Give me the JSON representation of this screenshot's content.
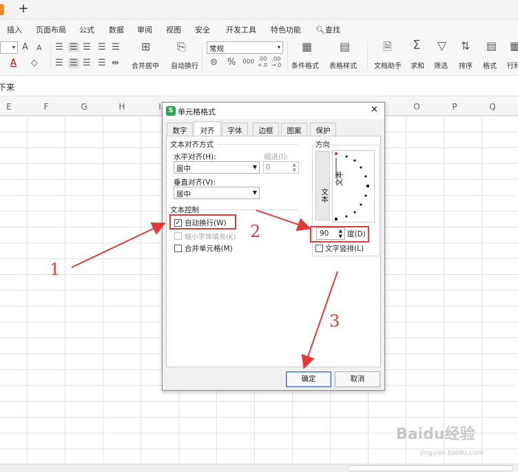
{
  "tabstrip": {
    "new_tab_glyph": "+"
  },
  "menu": [
    "插入",
    "页面布局",
    "公式",
    "数据",
    "审阅",
    "视图",
    "安全",
    "开发工具",
    "特色功能",
    "查找"
  ],
  "ribbon": {
    "font_size_value": "",
    "font_grow": "A",
    "font_shrink": "A",
    "font_color": "A",
    "number_format": "常规",
    "buttons": [
      "合并居中",
      "自动换行",
      "条件格式",
      "表格样式",
      "文档助手",
      "求和",
      "筛选",
      "排序",
      "格式",
      "行利"
    ],
    "percent": "%",
    "thousands": "000",
    "dec_up": ".00 +.0",
    "dec_down": ".00 →.0"
  },
  "formula_bar": {
    "text": "下来"
  },
  "columns": [
    "E",
    "F",
    "G",
    "H",
    "I",
    "O",
    "P",
    "Q"
  ],
  "dialog": {
    "title": "单元格格式",
    "logo": "S",
    "close": "✕",
    "tabs": [
      "数字",
      "对齐",
      "字体",
      "边框",
      "图案",
      "保护"
    ],
    "active_tab": "对齐",
    "text_align_group": "文本对齐方式",
    "horizontal_label": "水平对齐(H):",
    "horizontal_value": "居中",
    "indent_label": "缩进(I):",
    "indent_value": "0",
    "vertical_label": "垂直对齐(V):",
    "vertical_value": "居中",
    "text_control_group": "文本控制",
    "wrap_text": {
      "label": "自动换行(W)",
      "checked": true
    },
    "shrink_to_fit": {
      "label": "缩小字体填充(K)",
      "checked": false,
      "disabled": true
    },
    "merge_cells": {
      "label": "合并单元格(M)",
      "checked": false
    },
    "orientation_group": "方向",
    "vertical_text_button": "文本",
    "dial_text": "文本",
    "degrees_value": "90",
    "degrees_label": "度(D)",
    "vertical_stack": {
      "label": "文字竖排(L)",
      "checked": false
    },
    "ok": "确定",
    "cancel": "取消"
  },
  "annotations": [
    "1",
    "2",
    "3"
  ],
  "watermark": {
    "brand": "Baidu经验",
    "url": "jingyan.baidu.com"
  },
  "colors": {
    "annotation_red": "#e23a3a",
    "accent_blue": "#3c78d8",
    "logo_green": "#2aa84a"
  }
}
